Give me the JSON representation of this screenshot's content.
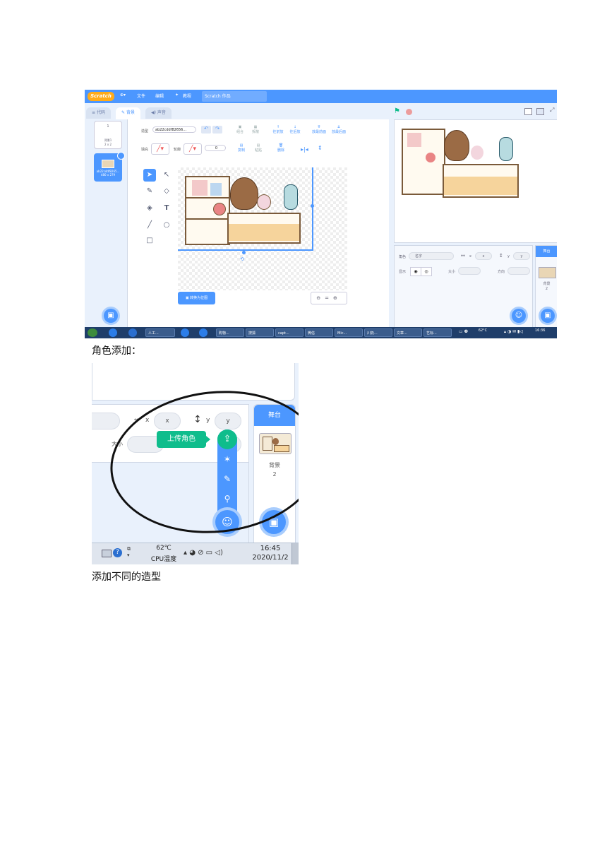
{
  "screenshot1": {
    "menubar": {
      "logo": "Scratch",
      "items": [
        "文件",
        "编辑",
        "教程"
      ],
      "project_title": "Scratch 作品"
    },
    "tabs": [
      "代码",
      "背景",
      "声音"
    ],
    "backdrops": [
      {
        "name": "背景1",
        "size": "2 x 2"
      },
      {
        "name": "ab22cddf8265...",
        "size": "480 x 279"
      }
    ],
    "paint": {
      "costume_label": "造型",
      "costume_name": "ab22cddf82656...",
      "fill_label": "填充",
      "outline_label": "轮廓",
      "outline_width": "0",
      "row1_tools": [
        "组合",
        "拆散",
        "往前放",
        "往后放",
        "放最前面",
        "放最后面"
      ],
      "row2_tools": [
        "复制",
        "粘贴",
        "删除"
      ],
      "convert_button": "转换为位图"
    },
    "sprite_info": {
      "sprite_label": "角色",
      "sprite_placeholder": "名字",
      "x_placeholder": "x",
      "y_placeholder": "y",
      "show_label": "显示",
      "size_label": "大小",
      "direction_label": "方向"
    },
    "stage_panel": {
      "header": "舞台",
      "backdrops_label": "背景",
      "backdrops_count": "2"
    },
    "taskbar": {
      "buttons": [
        "人工...",
        "购物...",
        "搜狐",
        "capt...",
        "微信",
        "Mic...",
        "川奶...",
        "文章...",
        "艺标..."
      ],
      "temp": "62°C",
      "clock": "16:36"
    }
  },
  "caption1": "角色添加：",
  "screenshot2": {
    "x_label": "x",
    "x_placeholder": "x",
    "y_label": "y",
    "y_placeholder": "y",
    "upload_tooltip": "上传角色",
    "stage_header": "舞台",
    "backdrops_label": "背景",
    "backdrops_count": "2",
    "taskbar": {
      "temp": "62℃",
      "temp_label": "CPU温度",
      "time": "16:45",
      "date": "2020/11/2"
    }
  },
  "caption2": "添加不同的造型"
}
